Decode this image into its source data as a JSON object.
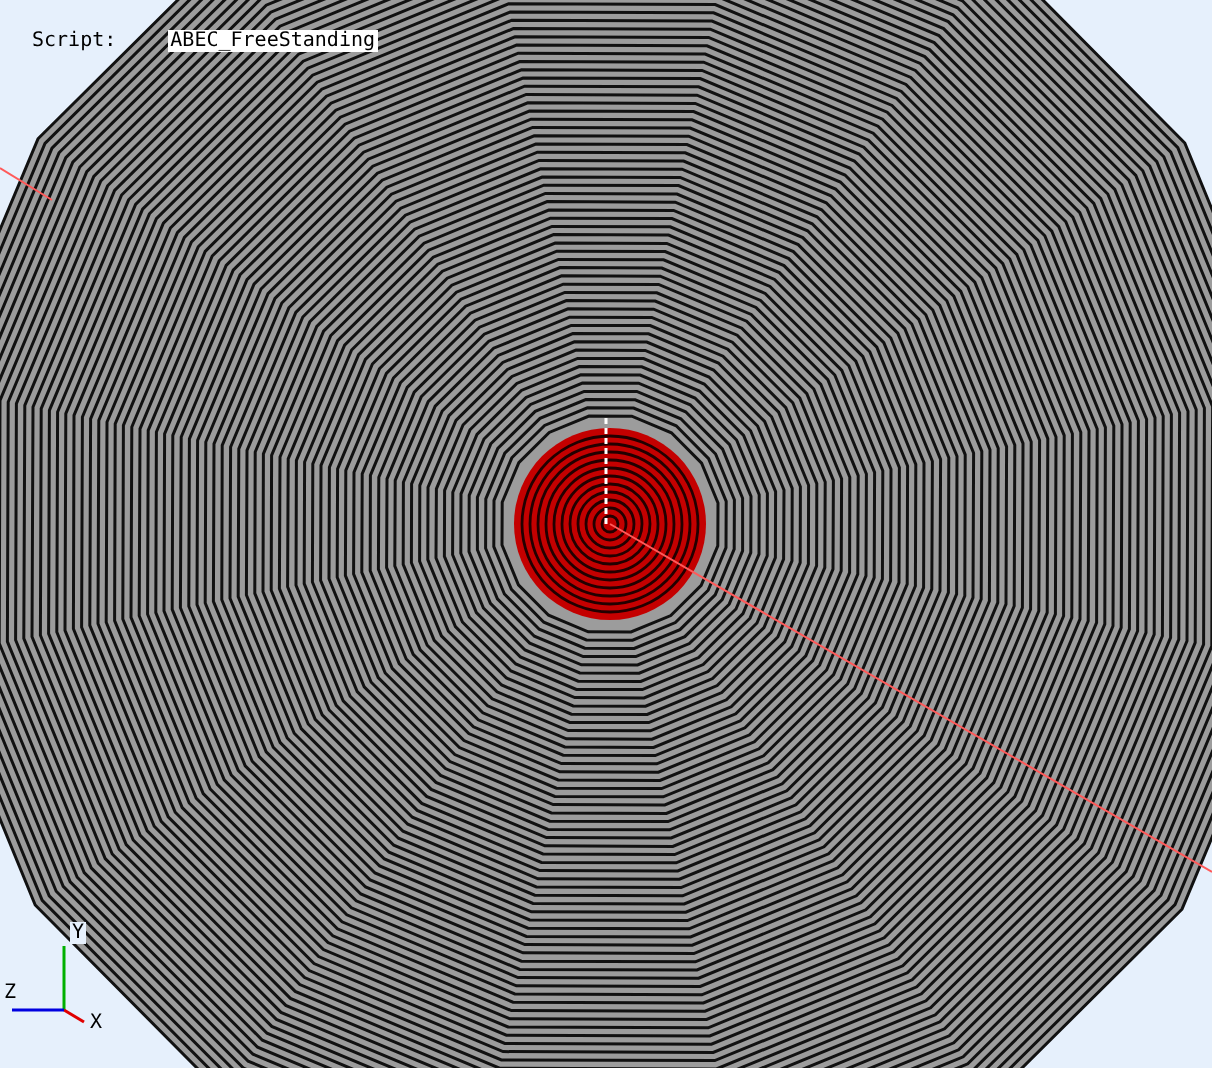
{
  "script": {
    "label": "Script:",
    "value": "ABEC_FreeStanding"
  },
  "axes": {
    "x": "X",
    "y": "Y",
    "z": "Z"
  }
}
